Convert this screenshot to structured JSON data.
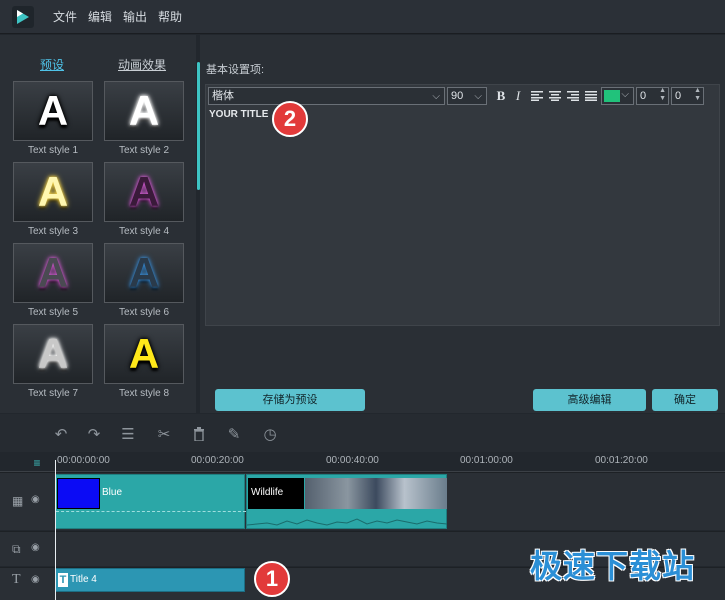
{
  "menu": {
    "items": [
      "文件",
      "编辑",
      "输出",
      "帮助"
    ]
  },
  "styles_panel": {
    "tabs": [
      "预设",
      "动画效果"
    ],
    "styles": [
      {
        "label": "Text style 1",
        "glyph": "A",
        "color": "#ffffff",
        "glow": "#000000"
      },
      {
        "label": "Text style 2",
        "glyph": "A",
        "color": "#ffffff",
        "glow": "#ffffff"
      },
      {
        "label": "Text style 3",
        "glyph": "A",
        "color": "#fff7b0",
        "glow": "#f3d24a"
      },
      {
        "label": "Text style 4",
        "glyph": "A",
        "color": "#3a1a3a",
        "glow": "#d15ad1"
      },
      {
        "label": "Text style 5",
        "glyph": "A",
        "color": "#4a4a52",
        "glow": "#c85ac8"
      },
      {
        "label": "Text style 6",
        "glyph": "A",
        "color": "#2a3a4a",
        "glow": "#3a8ad0"
      },
      {
        "label": "Text style 7",
        "glyph": "A",
        "color": "#c8c8c8",
        "glow": "#ffffff"
      },
      {
        "label": "Text style 8",
        "glyph": "A",
        "color": "#ffe81a",
        "glow": "#000000"
      }
    ]
  },
  "editor": {
    "section_label": "基本设置项:",
    "font": "楷体",
    "font_size": "90",
    "bold": "B",
    "italic": "I",
    "text_color": "#21c27b",
    "spin1": "0",
    "spin2": "0",
    "content": "YOUR TITLE"
  },
  "buttons": {
    "save_preset": "存储为预设",
    "advanced": "高级编辑",
    "ok": "确定"
  },
  "badges": [
    "2",
    "1"
  ],
  "timeline": {
    "ticks": [
      "00:00:00:00",
      "00:00:20:00",
      "00:00:40:00",
      "00:01:00:00",
      "00:01:20:00"
    ],
    "video_clips": [
      "Blue",
      "Wildlife"
    ],
    "title_clip": "Title 4"
  },
  "watermark": "极速下载站"
}
